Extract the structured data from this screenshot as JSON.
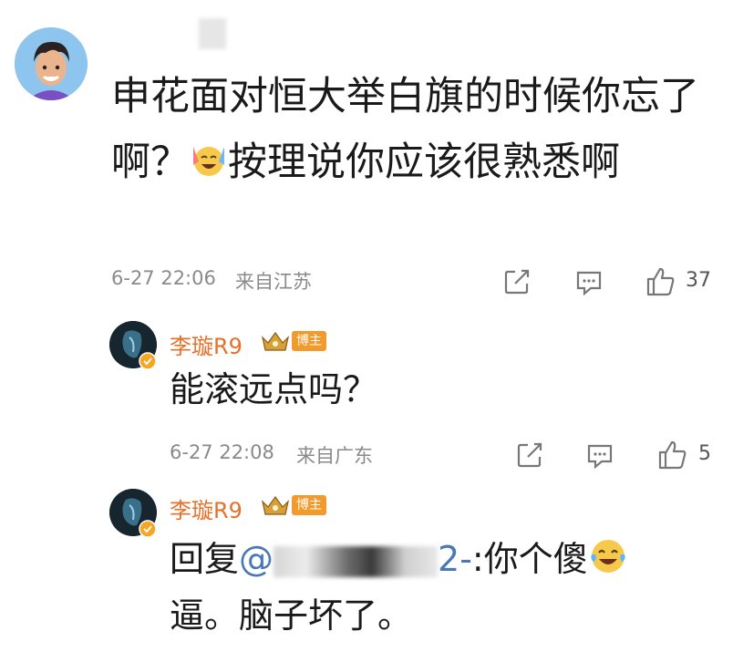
{
  "comment": {
    "text_part1": "申花面对恒大举白旗的时候你忘了啊？",
    "text_part2": "按理说你应该很熟悉啊",
    "time": "6-27 22:06",
    "location": "来自江苏",
    "like_count": "37",
    "emoji_icon": "crying-laughing-emoji"
  },
  "replies": [
    {
      "username": "李璇R9",
      "badge": "博主",
      "text": "能滚远点吗？",
      "time": "6-27 22:08",
      "location": "来自广东",
      "like_count": "5"
    },
    {
      "username": "李璇R9",
      "badge": "博主",
      "reply_prefix": "回复",
      "mention_start": "@",
      "mention_end": "2-",
      "reply_body_part1": ":你个傻",
      "reply_body_part2": "逼。脑子坏了。"
    }
  ],
  "colors": {
    "username": "#e7702a",
    "badge": "#f39a2c",
    "mention": "#4a78b6",
    "meta": "#8a8a8a"
  }
}
